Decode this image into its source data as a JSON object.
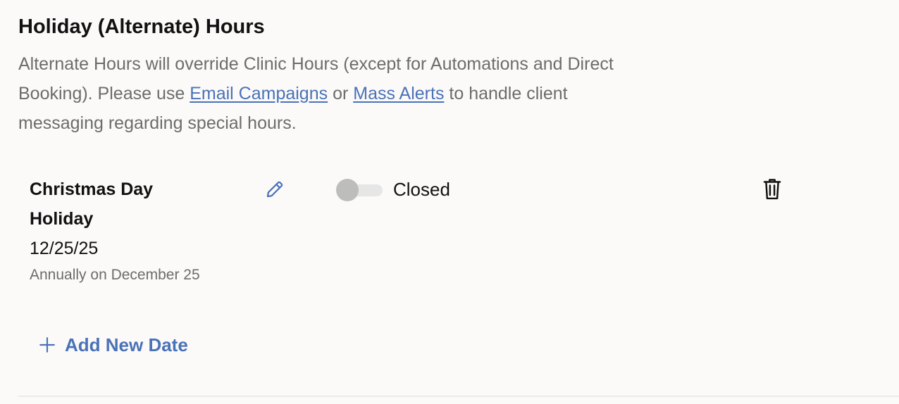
{
  "section": {
    "title": "Holiday (Alternate) Hours",
    "description_before": "Alternate Hours will override Clinic Hours (except for Automations and Direct Booking). Please use ",
    "email_campaigns_link": "Email Campaigns",
    "description_middle": " or ",
    "mass_alerts_link": "Mass Alerts",
    "description_after": " to handle client messaging regarding special hours."
  },
  "holidays": [
    {
      "name": "Christmas Day Holiday",
      "date": "12/25/25",
      "recurrence": "Annually on December 25",
      "is_open": false,
      "status_label": "Closed",
      "edit_icon": "pencil-icon",
      "delete_icon": "trash-icon"
    }
  ],
  "add_date": {
    "label": "Add New Date",
    "icon": "plus-icon"
  },
  "colors": {
    "link": "#4a72b8",
    "muted_text": "#6c6c6c",
    "toggle_off_knob": "#bdbdbb",
    "toggle_off_track": "#e6e6e6",
    "background": "#fbfaf8"
  }
}
